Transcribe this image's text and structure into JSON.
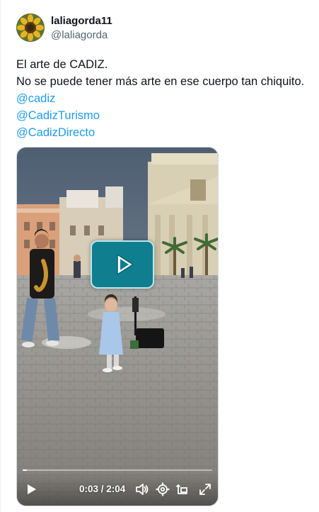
{
  "author": {
    "display_name": "laliagorda11",
    "handle": "@laliagorda",
    "avatar_icon": "sunflower-avatar"
  },
  "tweet": {
    "lines": [
      "El arte de CADIZ.",
      "No se puede tener más arte en ese cuerpo tan chiquito."
    ],
    "mentions": [
      "@cadiz",
      "@CadizTurismo",
      "@CadizDirecto"
    ]
  },
  "video": {
    "current_time": "0:03",
    "duration": "2:04",
    "time_display": "0:03 / 2:04",
    "progress_percent": 2.4,
    "center_overlay_icon": "play-icon",
    "controls": [
      "play-icon",
      "volume-icon",
      "settings-icon",
      "pip-icon",
      "fullscreen-icon"
    ]
  },
  "colors": {
    "link": "#1d9bf0",
    "text": "#0f1419",
    "muted": "#536471",
    "overlay": "#0f7f8f"
  }
}
